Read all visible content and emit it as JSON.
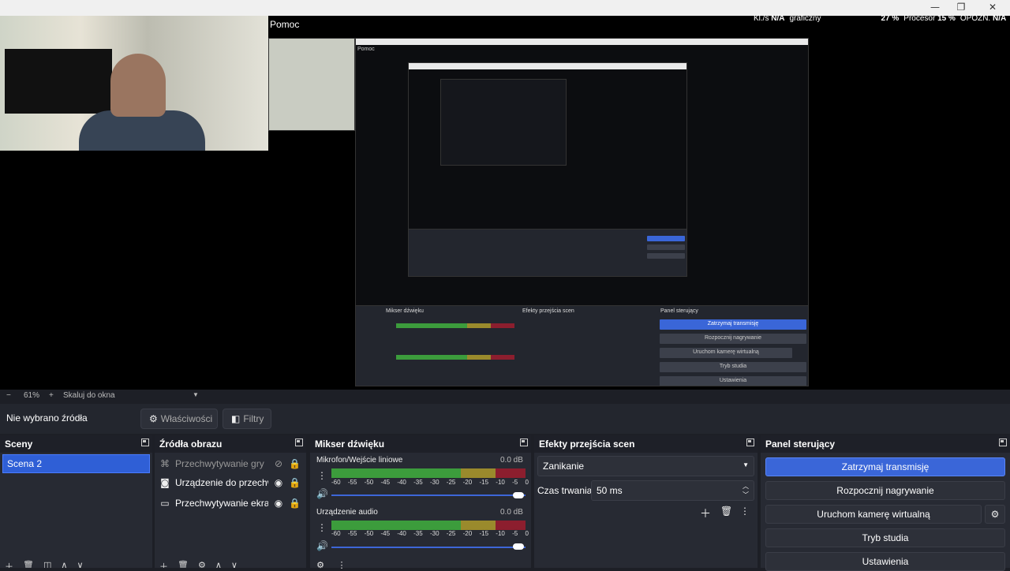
{
  "titlebar": {
    "stats": [
      {
        "label": "Kl./s",
        "value": "N/A"
      },
      {
        "label": "graficzny",
        "value": ""
      },
      {
        "label": "",
        "value": "27 %"
      },
      {
        "label": "Procesor",
        "value": "15 %"
      },
      {
        "label": "OPÓŹN.",
        "value": "N/A"
      }
    ],
    "minimize": "—",
    "restore": "❐",
    "close": "✕"
  },
  "menubar": {
    "help": "Pomoc"
  },
  "zoombar": {
    "minus": "−",
    "zoom": "61%",
    "plus": "+",
    "scale_mode": "Skaluj do okna"
  },
  "source_bar": {
    "status": "Nie wybrano źródła",
    "properties": "Właściwości",
    "filters": "Filtry"
  },
  "scenes": {
    "title": "Sceny",
    "items": [
      {
        "label": "Scena 2"
      }
    ]
  },
  "sources": {
    "title": "Źródła obrazu",
    "items": [
      {
        "label": "Przechwytywanie gry",
        "icon": "gamepad-icon"
      },
      {
        "label": "Urządzenie do przechw",
        "icon": "camera-icon"
      },
      {
        "label": "Przechwytywanie ekran",
        "icon": "monitor-icon"
      }
    ]
  },
  "mixer": {
    "title": "Mikser dźwięku",
    "ticks": [
      "-60",
      "-55",
      "-50",
      "-45",
      "-40",
      "-35",
      "-30",
      "-25",
      "-20",
      "-15",
      "-10",
      "-5",
      "0"
    ],
    "channels": [
      {
        "name": "Mikrofon/Wejście liniowe",
        "db": "0.0 dB"
      },
      {
        "name": "Urządzenie audio",
        "db": "0.0 dB"
      }
    ]
  },
  "transitions": {
    "title": "Efekty przejścia scen",
    "type": "Zanikanie",
    "duration_label": "Czas trwania",
    "duration_value": "50 ms"
  },
  "controls": {
    "title": "Panel sterujący",
    "buttons": [
      "Zatrzymaj transmisję",
      "Rozpocznij nagrywanie",
      "Uruchom kamerę wirtualną",
      "Tryb studia",
      "Ustawienia"
    ]
  },
  "colors": {
    "accent": "#3a66d8",
    "meter_green": "#3c9c3c",
    "meter_yellow": "#9a8a2c",
    "meter_red": "#8c1e2e"
  }
}
